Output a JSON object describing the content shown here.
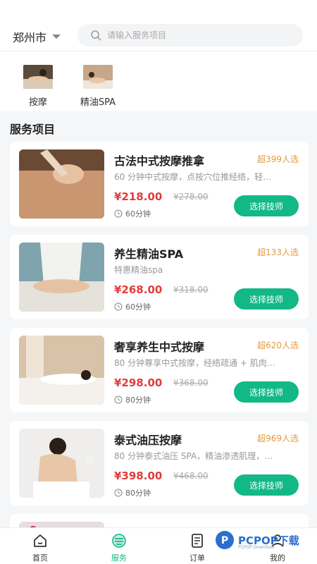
{
  "header": {
    "city": "郑州市",
    "search_placeholder": "请输入服务项目"
  },
  "categories": [
    {
      "label": "按摩"
    },
    {
      "label": "精油SPA"
    }
  ],
  "section_title": "服务项目",
  "services": [
    {
      "title": "古法中式按摩推拿",
      "popularity": "超399人选",
      "desc": "60 分钟中式按摩，点按穴位推经络，轻…",
      "price": "¥218.00",
      "original_price": "¥278.00",
      "duration": "60分钟",
      "button": "选择技师"
    },
    {
      "title": "养生精油SPA",
      "popularity": "超133人选",
      "desc": "特惠精油spa",
      "price": "¥268.00",
      "original_price": "¥318.00",
      "duration": "60分钟",
      "button": "选择技师"
    },
    {
      "title": "奢享养生中式按摩",
      "popularity": "超620人选",
      "desc": "80 分钟尊享中式按摩，经络疏通 + 肌肉…",
      "price": "¥298.00",
      "original_price": "¥368.00",
      "duration": "80分钟",
      "button": "选择技师"
    },
    {
      "title": "泰式油压按摩",
      "popularity": "超969人选",
      "desc": "80 分钟泰式油压 SPA，精油渗透肌理，…",
      "price": "¥398.00",
      "original_price": "¥468.00",
      "duration": "80分钟",
      "button": "选择技师"
    }
  ],
  "tabbar": {
    "items": [
      {
        "label": "首页"
      },
      {
        "label": "服务"
      },
      {
        "label": "订单"
      },
      {
        "label": "我的"
      }
    ]
  },
  "watermark": {
    "text": "PCPOP下载",
    "sub": "PCPOP Download"
  },
  "colors": {
    "accent": "#12b886",
    "price": "#e23b3b",
    "popularity": "#e59a3a"
  }
}
